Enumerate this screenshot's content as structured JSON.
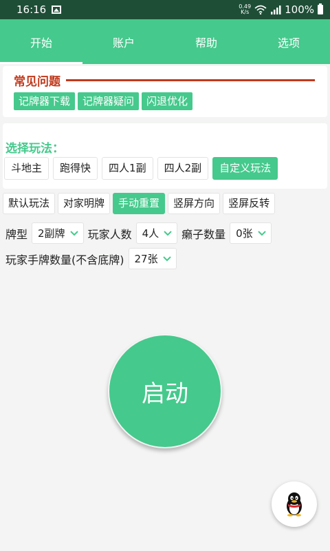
{
  "status_bar": {
    "time": "16:16",
    "net_speed_value": "0.49",
    "net_speed_unit": "K/s",
    "battery": "100%",
    "icons": [
      "image-icon",
      "wifi-icon",
      "signal-icon",
      "battery-icon"
    ]
  },
  "tabs": [
    {
      "label": "开始",
      "active": true
    },
    {
      "label": "账户",
      "active": false
    },
    {
      "label": "帮助",
      "active": false
    },
    {
      "label": "选项",
      "active": false
    }
  ],
  "faq": {
    "title": "常见问题",
    "buttons": [
      "记牌器下载",
      "记牌器疑问",
      "闪退优化"
    ]
  },
  "play_mode": {
    "label": "选择玩法：",
    "options": [
      "斗地主",
      "跑得快",
      "四人1副",
      "四人2副",
      "自定义玩法"
    ],
    "selected": "自定义玩法"
  },
  "toggles": {
    "items": [
      "默认玩法",
      "对家明牌",
      "手动重置",
      "竖屏方向",
      "竖屏反转"
    ],
    "selected": "手动重置"
  },
  "settings": {
    "card_type_label": "牌型",
    "card_type_value": "2副牌",
    "player_count_label": "玩家人数",
    "player_count_value": "4人",
    "wild_count_label": "癞子数量",
    "wild_count_value": "0张",
    "hand_size_label": "玩家手牌数量(不含底牌)",
    "hand_size_value": "27张"
  },
  "start_label": "启动",
  "colors": {
    "accent": "#45c98c",
    "status_bar": "#1f4e37",
    "faq_red": "#c0391b"
  }
}
